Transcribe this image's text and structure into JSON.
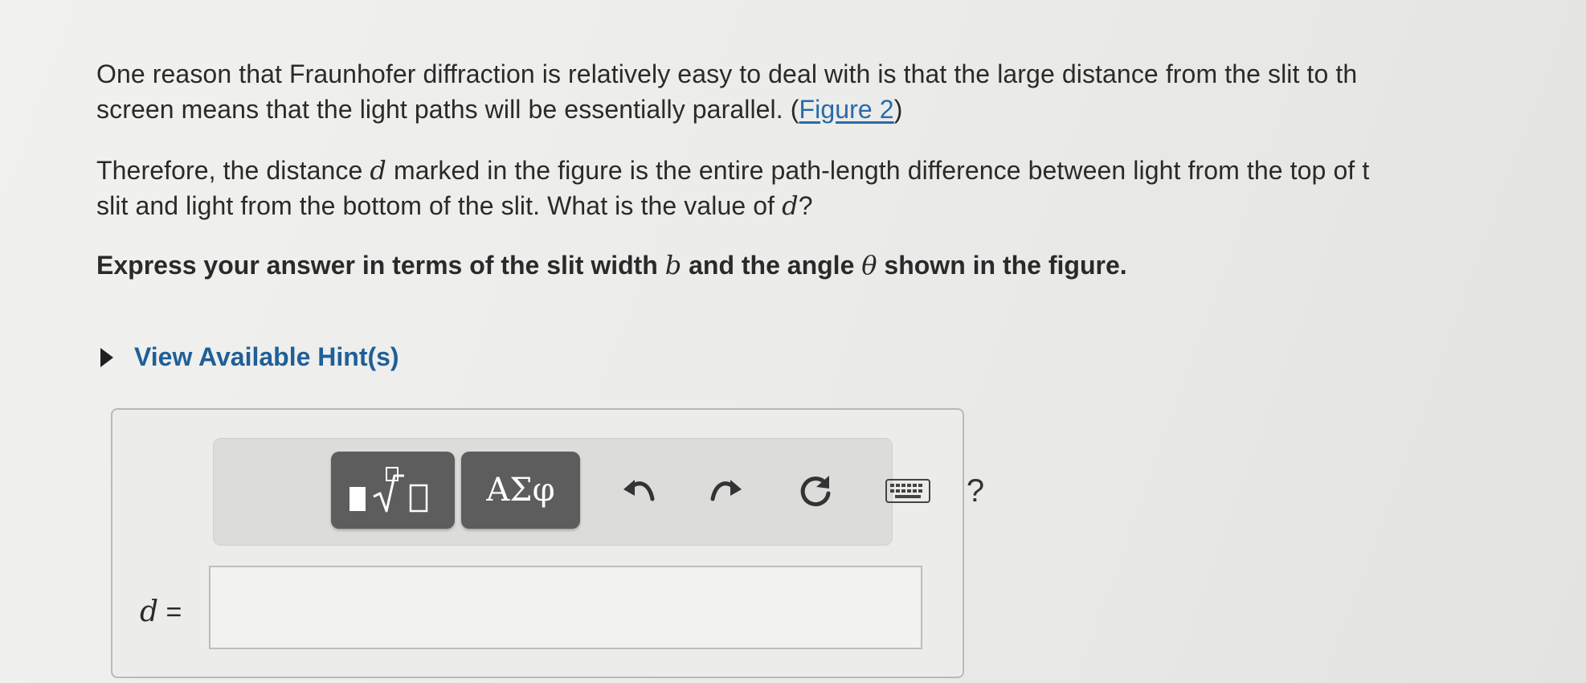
{
  "question": {
    "para1_line1": "One reason that Fraunhofer diffraction is relatively easy to deal with is that the large distance from the slit to th",
    "para1_line2_prefix": "screen means that the light paths will be essentially parallel. (",
    "figure_link": "Figure 2",
    "para1_line2_suffix": ")",
    "para2_line1_a": "Therefore, the distance ",
    "var_d": "d",
    "para2_line1_b": " marked in the figure is the entire path-length difference between light from the top of t",
    "para2_line2_a": "slit and light from the bottom of the slit. What is the value of ",
    "para2_line2_b": "?",
    "instruction_a": "Express your answer in terms of the slit width ",
    "var_b": "b",
    "instruction_b": " and the angle ",
    "var_theta": "θ",
    "instruction_c": " shown in the figure."
  },
  "hints": {
    "label": "View Available Hint(s)",
    "icon": "triangle-right-icon"
  },
  "toolbar": {
    "templates_icon": "templates-radical-icon",
    "symbols_label": "ΑΣφ",
    "undo_icon": "undo-icon",
    "redo_icon": "redo-icon",
    "reset_icon": "reset-icon",
    "keyboard_icon": "keyboard-icon",
    "help_label": "?"
  },
  "answer": {
    "variable": "d",
    "equals": "=",
    "value": "",
    "placeholder": ""
  },
  "colors": {
    "link": "#2a6aa8",
    "hint_text": "#1f5f98",
    "toolbar_button": "#5d5d5d"
  }
}
